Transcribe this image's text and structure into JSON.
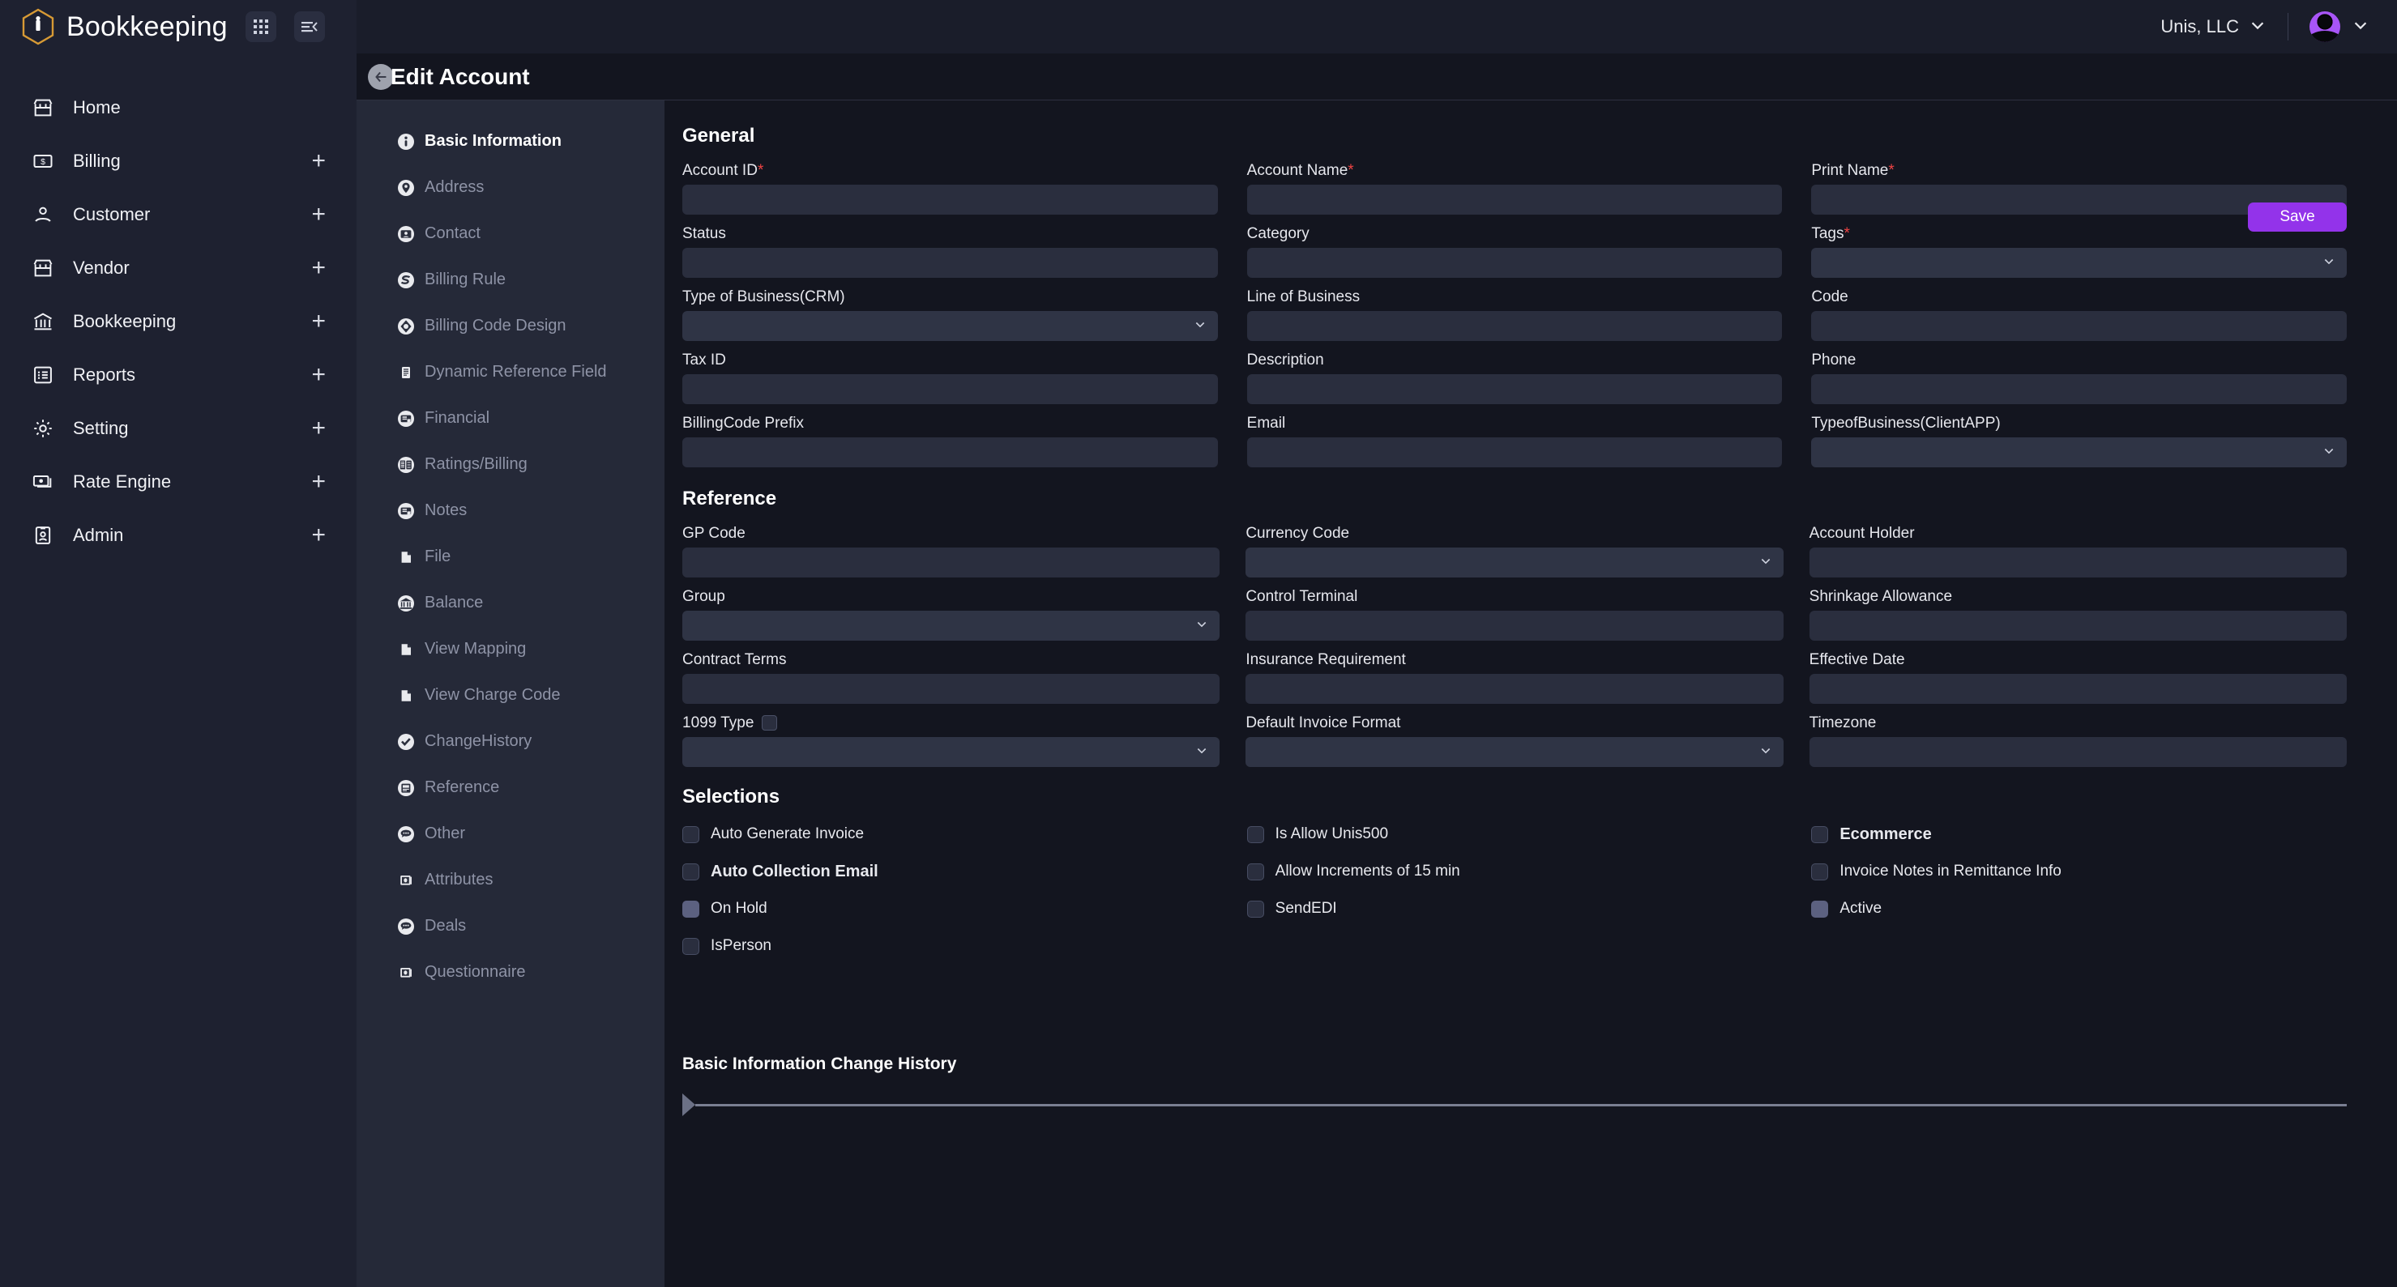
{
  "brand": {
    "title": "Bookkeeping",
    "apps_icon": "grid-apps-icon",
    "collapse_icon": "collapse-sidebar-icon"
  },
  "topbar": {
    "org": "Unis, LLC",
    "org_chevron_icon": "chevron-down-icon",
    "avatar_icon": "user-avatar",
    "avatar_chevron_icon": "chevron-down-icon"
  },
  "sidebar": {
    "items": [
      {
        "label": "Home",
        "icon": "storefront-icon",
        "expandable": false
      },
      {
        "label": "Billing",
        "icon": "money-bill-icon",
        "expandable": true
      },
      {
        "label": "Customer",
        "icon": "person-icon",
        "expandable": true
      },
      {
        "label": "Vendor",
        "icon": "storefront-icon",
        "expandable": true
      },
      {
        "label": "Bookkeeping",
        "icon": "bank-icon",
        "expandable": true
      },
      {
        "label": "Reports",
        "icon": "list-report-icon",
        "expandable": true
      },
      {
        "label": "Setting",
        "icon": "gear-icon",
        "expandable": true
      },
      {
        "label": "Rate Engine",
        "icon": "cash-stack-icon",
        "expandable": true
      },
      {
        "label": "Admin",
        "icon": "id-badge-icon",
        "expandable": true
      }
    ],
    "plus_label": "+"
  },
  "page": {
    "title": "Edit Account",
    "back_icon": "back-arrow-icon"
  },
  "section_nav": {
    "items": [
      {
        "label": "Basic Information",
        "icon": "info-circle-icon",
        "active": true
      },
      {
        "label": "Address",
        "icon": "map-pin-icon",
        "active": false
      },
      {
        "label": "Contact",
        "icon": "contact-card-icon",
        "active": false
      },
      {
        "label": "Billing Rule",
        "icon": "billing-rule-icon",
        "active": false
      },
      {
        "label": "Billing Code Design",
        "icon": "billing-code-icon",
        "active": false
      },
      {
        "label": "Dynamic Reference Field",
        "icon": "document-lines-icon",
        "active": false
      },
      {
        "label": "Financial",
        "icon": "financial-doc-icon",
        "active": false
      },
      {
        "label": "Ratings/Billing",
        "icon": "ratings-billing-icon",
        "active": false
      },
      {
        "label": "Notes",
        "icon": "notes-icon",
        "active": false
      },
      {
        "label": "File",
        "icon": "file-icon",
        "active": false
      },
      {
        "label": "Balance",
        "icon": "bank-icon",
        "active": false
      },
      {
        "label": "View Mapping",
        "icon": "file-icon",
        "active": false
      },
      {
        "label": "View Charge Code",
        "icon": "file-icon",
        "active": false
      },
      {
        "label": "ChangeHistory",
        "icon": "check-history-icon",
        "active": false
      },
      {
        "label": "Reference",
        "icon": "reference-doc-icon",
        "active": false
      },
      {
        "label": "Other",
        "icon": "chat-bubble-icon",
        "active": false
      },
      {
        "label": "Attributes",
        "icon": "attributes-icon",
        "active": false
      },
      {
        "label": "Deals",
        "icon": "chat-bubble-icon",
        "active": false
      },
      {
        "label": "Questionnaire",
        "icon": "attributes-icon",
        "active": false
      }
    ]
  },
  "toolbar": {
    "save_label": "Save"
  },
  "general": {
    "title": "General",
    "fields": [
      {
        "label": "Account ID",
        "required": true,
        "type": "text",
        "value": ""
      },
      {
        "label": "Account Name",
        "required": true,
        "type": "text",
        "value": ""
      },
      {
        "label": "Print Name",
        "required": true,
        "type": "text",
        "value": ""
      },
      {
        "label": "Status",
        "required": false,
        "type": "text",
        "value": ""
      },
      {
        "label": "Category",
        "required": false,
        "type": "text",
        "value": ""
      },
      {
        "label": "Tags",
        "required": true,
        "type": "select",
        "value": ""
      },
      {
        "label": "Type of Business(CRM)",
        "required": false,
        "type": "select",
        "value": ""
      },
      {
        "label": "Line of Business",
        "required": false,
        "type": "text",
        "value": ""
      },
      {
        "label": "Code",
        "required": false,
        "type": "text",
        "value": ""
      },
      {
        "label": "Tax ID",
        "required": false,
        "type": "text",
        "value": ""
      },
      {
        "label": "Description",
        "required": false,
        "type": "text",
        "value": ""
      },
      {
        "label": "Phone",
        "required": false,
        "type": "text",
        "value": ""
      },
      {
        "label": "BillingCode Prefix",
        "required": false,
        "type": "text",
        "value": ""
      },
      {
        "label": "Email",
        "required": false,
        "type": "text",
        "value": ""
      },
      {
        "label": "TypeofBusiness(ClientAPP)",
        "required": false,
        "type": "select",
        "value": ""
      }
    ]
  },
  "reference": {
    "title": "Reference",
    "fields": [
      {
        "label": "GP Code",
        "required": false,
        "type": "text",
        "value": ""
      },
      {
        "label": "Currency Code",
        "required": false,
        "type": "select",
        "value": ""
      },
      {
        "label": "Account Holder",
        "required": false,
        "type": "text",
        "value": ""
      },
      {
        "label": "Group",
        "required": false,
        "type": "select",
        "value": ""
      },
      {
        "label": "Control Terminal",
        "required": false,
        "type": "text",
        "value": ""
      },
      {
        "label": "Shrinkage Allowance",
        "required": false,
        "type": "text",
        "value": ""
      },
      {
        "label": "Contract Terms",
        "required": false,
        "type": "text",
        "value": ""
      },
      {
        "label": "Insurance Requirement",
        "required": false,
        "type": "text",
        "value": ""
      },
      {
        "label": "Effective Date",
        "required": false,
        "type": "text",
        "value": ""
      },
      {
        "label": "1099 Type",
        "required": false,
        "type": "select",
        "value": "",
        "extra_checkbox": true
      },
      {
        "label": "Default Invoice Format",
        "required": false,
        "type": "select",
        "value": ""
      },
      {
        "label": "Timezone",
        "required": false,
        "type": "text",
        "value": ""
      }
    ]
  },
  "selections": {
    "title": "Selections",
    "col1": [
      {
        "label": "Auto Generate Invoice",
        "checked": false,
        "bold": false
      },
      {
        "label": "Auto Collection Email",
        "checked": false,
        "bold": true
      },
      {
        "label": "On Hold",
        "checked": true,
        "bold": false
      },
      {
        "label": "IsPerson",
        "checked": false,
        "bold": false
      }
    ],
    "col2": [
      {
        "label": "Is Allow Unis500",
        "checked": false,
        "bold": false
      },
      {
        "label": "Allow Increments of 15 min",
        "checked": false,
        "bold": false
      },
      {
        "label": "SendEDI",
        "checked": false,
        "bold": false
      }
    ],
    "col3": [
      {
        "label": "Ecommerce",
        "checked": false,
        "bold": true
      },
      {
        "label": "Invoice Notes in Remittance Info",
        "checked": false,
        "bold": false
      },
      {
        "label": "Active",
        "checked": true,
        "bold": false
      }
    ]
  },
  "history": {
    "title": "Basic Information Change History",
    "expand_icon": "triangle-right-icon"
  },
  "colors": {
    "accent": "#9333ea",
    "required": "#ef4444",
    "logo": "#d79a35",
    "sidebar": "#1e2130",
    "secnav": "#252938",
    "page_bg": "#13151f"
  }
}
